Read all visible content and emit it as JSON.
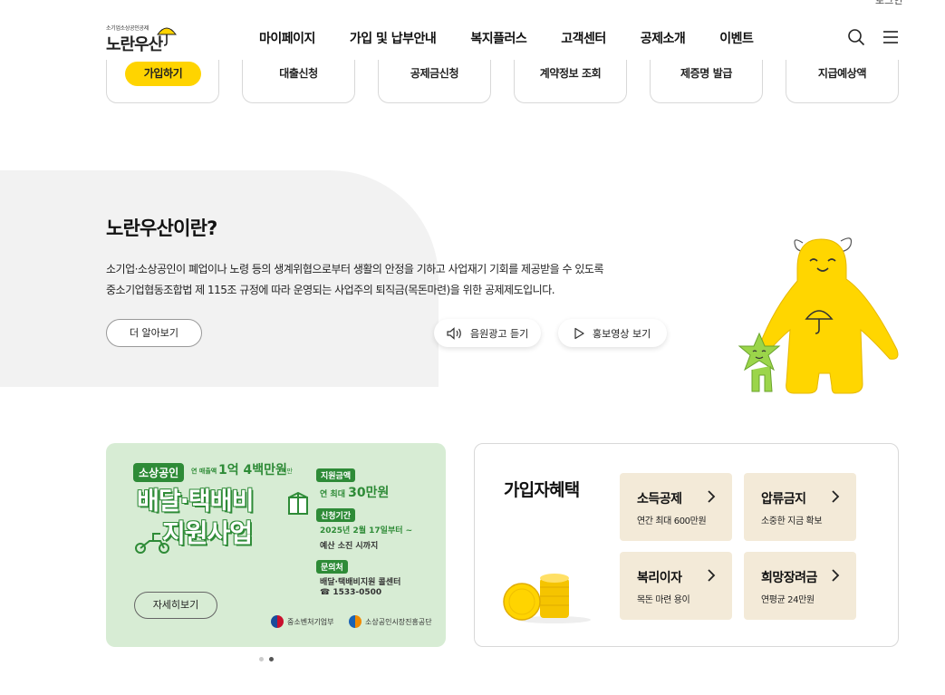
{
  "header": {
    "login": "로그인",
    "logo_small": "소기업소상공인공제",
    "logo_big": "노란우산",
    "nav": [
      "마이페이지",
      "가입 및 납부안내",
      "복지플러스",
      "고객센터",
      "공제소개",
      "이벤트"
    ],
    "search_icon": "search-icon",
    "menu_icon": "hamburger-icon"
  },
  "quick_menu": [
    "가입하기",
    "대출신청",
    "공제금신청",
    "계약정보 조회",
    "제증명 발급",
    "지급예상액"
  ],
  "intro": {
    "title": "노란우산이란?",
    "desc_line1": "소기업·소상공인이 폐업이나 노령 등의 생계위협으로부터 생활의 안정을 기하고 사업재기 기회를 제공받을 수 있도록",
    "desc_line2": "중소기업협동조합법 제 115조 규정에 따라 운영되는 사업주의 퇴직금(목돈마련)을 위한 공제제도입니다.",
    "more_button": "더 알아보기",
    "audio_button": "음원광고 듣기",
    "video_button": "홍보영상 보기"
  },
  "banner": {
    "tag": "소상공인",
    "tag_sub": "연 매출액",
    "tag_amount": "1억 4백만원",
    "tag_suffix": "미만",
    "title_line1": "배달·택배비",
    "title_line2": "지원사업",
    "support_label": "지원금액",
    "support_value_prefix": "연 최대 ",
    "support_value": "30만원",
    "period_label": "신청기간",
    "period_value": "2025년 2월 17일부터 ~",
    "period_note": "예산 소진 시까지",
    "contact_label": "문의처",
    "contact_name": "배달·택배비지원 콜센터",
    "contact_phone": "1533-0500",
    "detail_button": "자세히보기",
    "org1": "중소벤처기업부",
    "org2": "소상공인시장진흥공단"
  },
  "benefits": {
    "title": "가입자혜택",
    "items": [
      {
        "name": "소득공제",
        "sub": "연간 최대 600만원"
      },
      {
        "name": "압류금지",
        "sub": "소중한 지금 확보"
      },
      {
        "name": "복리이자",
        "sub": "목돈 마련 용이"
      },
      {
        "name": "희망장려금",
        "sub": "연평균 24만원"
      }
    ]
  },
  "colors": {
    "accent": "#ffd400",
    "banner_green": "#2e8b37",
    "benefit_bg": "#f3ead8"
  }
}
